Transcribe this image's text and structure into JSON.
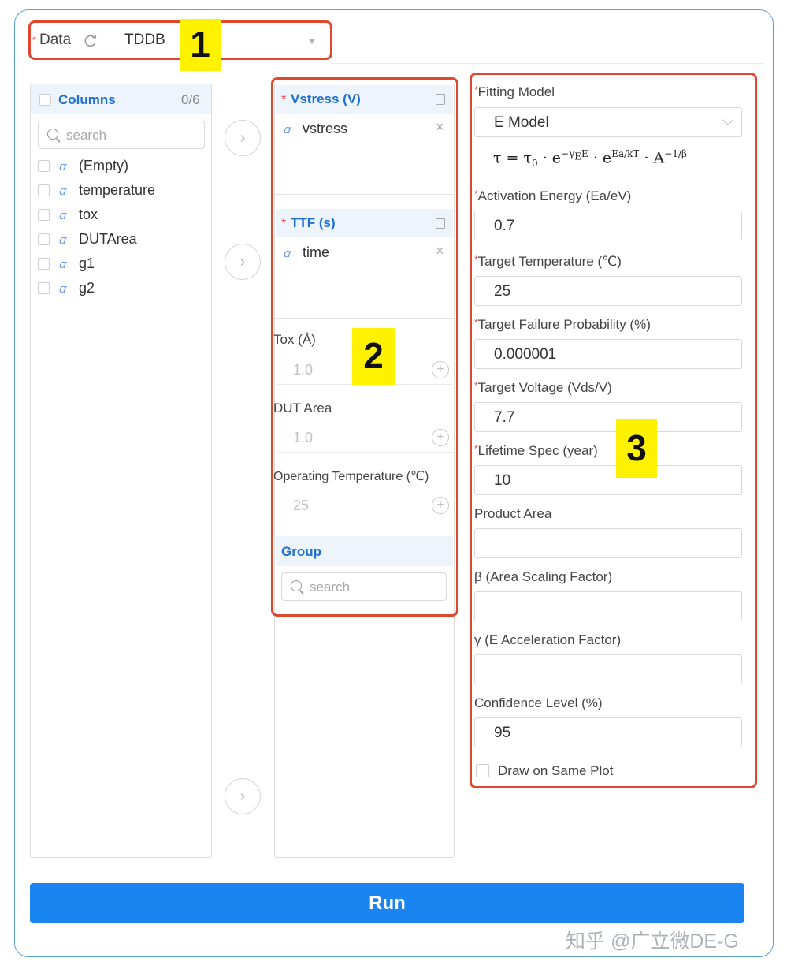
{
  "data_selector": {
    "label": "Data",
    "value": "TDDB"
  },
  "callouts": [
    "1",
    "2",
    "3"
  ],
  "columns_panel": {
    "header": "Columns",
    "count": "0/6",
    "search_placeholder": "search",
    "items": [
      {
        "icon": "text-field-icon",
        "label": "(Empty)"
      },
      {
        "icon": "text-field-icon",
        "label": "temperature"
      },
      {
        "icon": "text-field-icon",
        "label": "tox"
      },
      {
        "icon": "text-field-icon",
        "label": "DUTArea"
      },
      {
        "icon": "text-field-icon",
        "label": "g1"
      },
      {
        "icon": "text-field-icon",
        "label": "g2"
      }
    ]
  },
  "mapping_panel": {
    "vstress": {
      "title": "Vstress (V)",
      "item": "vstress"
    },
    "ttf": {
      "title": "TTF (s)",
      "item": "time"
    },
    "tox": {
      "label": "Tox (Å)",
      "value": "1.0"
    },
    "dut_area": {
      "label": "DUT Area",
      "value": "1.0"
    },
    "operating_temperature": {
      "label": "Operating Temperature (℃)",
      "value": "25"
    },
    "group": {
      "title": "Group",
      "search_placeholder": "search"
    }
  },
  "settings_panel": {
    "fitting_model": {
      "label": "Fitting Model",
      "value": "E Model"
    },
    "activation_energy": {
      "label": "Activation Energy (Ea/eV)",
      "value": "0.7"
    },
    "target_temperature": {
      "label": "Target Temperature (℃)",
      "value": "25"
    },
    "target_failure_probability": {
      "label": "Target Failure Probability (%)",
      "value": "0.000001"
    },
    "target_voltage": {
      "label": "Target Voltage (Vds/V)",
      "value": "7.7"
    },
    "lifetime_spec": {
      "label": "Lifetime Spec (year)",
      "value": "10"
    },
    "product_area": {
      "label": "Product Area",
      "value": ""
    },
    "beta": {
      "label": "β (Area Scaling Factor)",
      "value": ""
    },
    "gamma": {
      "label": "γ (E Acceleration Factor)",
      "value": ""
    },
    "confidence_level": {
      "label": "Confidence Level (%)",
      "value": "95"
    },
    "draw_same_plot": {
      "label": "Draw on Same Plot",
      "checked": false
    }
  },
  "run_label": "Run",
  "watermark": "知乎 @广立微DE-G",
  "colors": {
    "accent": "#1a85f0",
    "highlight_box": "#e0472f",
    "callout": "#fff200",
    "required": "#e54848"
  }
}
